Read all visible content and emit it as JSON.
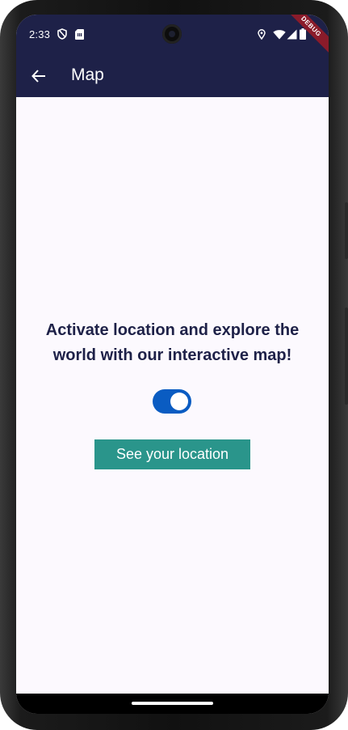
{
  "status_bar": {
    "time": "2:33",
    "icons": [
      "shield-icon",
      "sim-card-icon",
      "location-pin-icon",
      "wifi-icon",
      "signal-icon",
      "battery-icon"
    ],
    "debug_label": "DEBUG"
  },
  "app_bar": {
    "back_icon": "arrow-back-icon",
    "title": "Map",
    "background": "#1e2148"
  },
  "main": {
    "headline": "Activate location and explore the world with our interactive map!",
    "toggle": {
      "on": true,
      "color": "#0a5cc2"
    },
    "button_label": "See your location",
    "button_color": "#2a958b"
  }
}
